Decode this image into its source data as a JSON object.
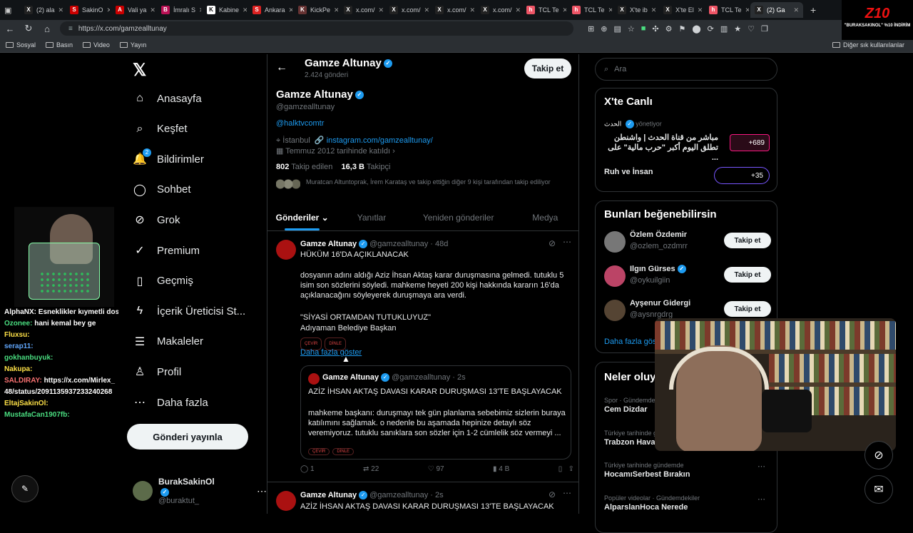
{
  "browser": {
    "tabs": [
      {
        "label": "(2) ala",
        "fav": "X",
        "color": "#222"
      },
      {
        "label": "SakinO",
        "fav": "S",
        "color": "#c00"
      },
      {
        "label": "Vali ya",
        "fav": "A",
        "color": "#c00"
      },
      {
        "label": "İmralı S",
        "fav": "B",
        "color": "#b15"
      },
      {
        "label": "Kabine",
        "fav": "K",
        "color": "#fff"
      },
      {
        "label": "Ankara",
        "fav": "S",
        "color": "#d22"
      },
      {
        "label": "KickPe",
        "fav": "K",
        "color": "#633"
      },
      {
        "label": "x.com/",
        "fav": "X",
        "color": "#222"
      },
      {
        "label": "x.com/",
        "fav": "X",
        "color": "#222"
      },
      {
        "label": "x.com/",
        "fav": "X",
        "color": "#222"
      },
      {
        "label": "x.com/",
        "fav": "X",
        "color": "#222"
      },
      {
        "label": "TCL Te",
        "fav": "h",
        "color": "#e56"
      },
      {
        "label": "TCL Te",
        "fav": "h",
        "color": "#e56"
      },
      {
        "label": "X'te ib",
        "fav": "X",
        "color": "#222"
      },
      {
        "label": "X'te El",
        "fav": "X",
        "color": "#222"
      },
      {
        "label": "TCL Te",
        "fav": "h",
        "color": "#e56"
      },
      {
        "label": "(2) Ga",
        "fav": "X",
        "color": "#222"
      }
    ],
    "url": "https://x.com/gamzealltunay",
    "bookmarks": [
      "Sosyal",
      "Basın",
      "Video",
      "Yayın"
    ],
    "other_bookmarks": "Diğer sık kullanılanlar"
  },
  "stream": {
    "logo_text": "Z10",
    "logo_sub": "\"BURAKSAKINOL\" %10 İNDİRİM",
    "chat": [
      {
        "user": "AlphaNX:",
        "msg": "Esneklikler kıymetli dostlar",
        "color": "#ffffff"
      },
      {
        "user": "Ozonee:",
        "msg": "hani kemal bey ge",
        "color": "#4ade80"
      },
      {
        "user": "Fluxsu:",
        "msg": "",
        "color": "#fde047"
      },
      {
        "user": "serap11:",
        "msg": "",
        "color": "#60a5fa"
      },
      {
        "user": "gokhanbuyuk:",
        "msg": "",
        "color": "#4ade80"
      },
      {
        "user": "Nakupa:",
        "msg": "",
        "color": "#fde047"
      },
      {
        "user": "SALDIRAY:",
        "msg": "https://x.com/Mirlex_48/status/2091135937233240268",
        "color": "#f87171"
      },
      {
        "user": "EltajSakinOl:",
        "msg": "",
        "color": "#fde047"
      },
      {
        "user": "MustafaCan1907fb:",
        "msg": "",
        "color": "#4ade80"
      }
    ]
  },
  "nav": {
    "items": [
      {
        "label": "Anasayfa",
        "icon": "home-icon",
        "glyph": "⌂"
      },
      {
        "label": "Keşfet",
        "icon": "search-icon",
        "glyph": "⌕"
      },
      {
        "label": "Bildirimler",
        "icon": "bell-icon",
        "glyph": "🔔",
        "badge": "2"
      },
      {
        "label": "Sohbet",
        "icon": "chat-icon",
        "glyph": "◯"
      },
      {
        "label": "Grok",
        "icon": "grok-icon",
        "glyph": "⊘"
      },
      {
        "label": "Premium",
        "icon": "premium-icon",
        "glyph": "✓"
      },
      {
        "label": "Geçmiş",
        "icon": "bookmark-icon",
        "glyph": "▯"
      },
      {
        "label": "İçerik Üreticisi St...",
        "icon": "lightning-icon",
        "glyph": "ϟ"
      },
      {
        "label": "Makaleler",
        "icon": "articles-icon",
        "glyph": "☰"
      },
      {
        "label": "Profil",
        "icon": "profile-icon",
        "glyph": "♙"
      },
      {
        "label": "Daha fazla",
        "icon": "more-icon",
        "glyph": "⋯"
      }
    ],
    "post_label": "Gönderi yayınla",
    "account_name": "BurakSakinOl",
    "account_handle": "@buraktut_"
  },
  "profile": {
    "name": "Gamze Altunay",
    "post_count": "2.424 gönderi",
    "handle": "@gamzealltunay",
    "bio": "@halktvcomtr",
    "location": "İstanbul",
    "link": "instagram.com/gamzealltunay/",
    "joined": "Temmuz 2012 tarihinde katıldı",
    "following_count": "802",
    "following_label": "Takip edilen",
    "followers_count": "16,3 B",
    "followers_label": "Takipçi",
    "followed_by": "Muratcan Altuntoprak, İrem Karataş ve takip ettiğin diğer 9 kişi tarafından takip ediliyor",
    "follow_label": "Takip et",
    "tabs": [
      "Gönderiler",
      "Yanıtlar",
      "Yeniden gönderiler",
      "Medya"
    ]
  },
  "tweet1": {
    "name": "Gamze Altunay",
    "handle": "@gamzealltunay",
    "time": "48d",
    "headline": "HÜKÜM 16'DA AÇIKLANACAK",
    "para1": "dosyanın adını aldığı Aziz İhsan Aktaş karar duruşmasına gelmedi. tutuklu 5 isim son sözlerini söyledi. mahkeme heyeti 200 kişi hakkında kararın 16'da açıklanacağını söyleyerek duruşmaya ara verdi.",
    "quote_line": "\"SİYASİ ORTAMDAN TUTUKLUYUZ\"",
    "signer": "Adıyaman Belediye Başkan",
    "chip_translate": "ÇEVİR",
    "chip_listen": "DİNLE",
    "show_more": "Daha fazla göster",
    "replies": "1",
    "retweets": "22",
    "likes": "97",
    "views": "4 B"
  },
  "quoted": {
    "name": "Gamze Altunay",
    "handle": "@gamzealltunay",
    "time": "2s",
    "headline": "AZİZ İHSAN AKTAŞ DAVASI KARAR DURUŞMASI 13'TE BAŞLAYACAK",
    "body": "mahkeme başkanı: duruşmayı tek gün planlama sebebimiz sizlerin buraya katılımını sağlamak. o nedenle bu aşamada hepinize detaylı söz veremiyoruz. tutuklu sanıklara son sözler için 1-2 cümlelik söz vermeyi ..."
  },
  "tweet2": {
    "name": "Gamze Altunay",
    "handle": "@gamzealltunay",
    "time": "2s",
    "headline": "AZİZ İHSAN AKTAŞ DAVASI KARAR DURUŞMASI 13'TE BAŞLAYACAK"
  },
  "sidebar": {
    "search_placeholder": "Ara",
    "live_title": "X'te Canlı",
    "live_host": "الحدث",
    "live_host_status": "yönetiyor",
    "live_text": "مباشر من قناة الحدث | واشنطن تطلق اليوم أكبر \"حرب مالية\" على ...",
    "live_count": "+689",
    "live2_title": "Ruh ve İnsan",
    "live2_count": "+35",
    "suggest_title": "Bunları beğenebilirsin",
    "suggestions": [
      {
        "name": "Özlem Özdemir",
        "handle": "@ozlem_ozdmrr",
        "verified": false
      },
      {
        "name": "Ilgın Gürses",
        "handle": "@oykuilgiin",
        "verified": true
      },
      {
        "name": "Ayşenur Gidergi",
        "handle": "@aysnrgdrg",
        "verified": false
      }
    ],
    "follow_label": "Takip et",
    "more_label": "Daha fazla göster",
    "trends_title": "Neler oluyor",
    "trends": [
      {
        "meta": "Spor · Gündemde",
        "name": "Cem Dizdar"
      },
      {
        "meta": "Türkiye tarihinde gündemde",
        "name": "Trabzon Havalimanı"
      },
      {
        "meta": "Türkiye tarihinde gündemde",
        "name": "HocamıSerbest Bırakın"
      },
      {
        "meta": "Popüler videolar · Gündemdekiler",
        "name": "AlparslanHoca Nerede"
      }
    ]
  }
}
